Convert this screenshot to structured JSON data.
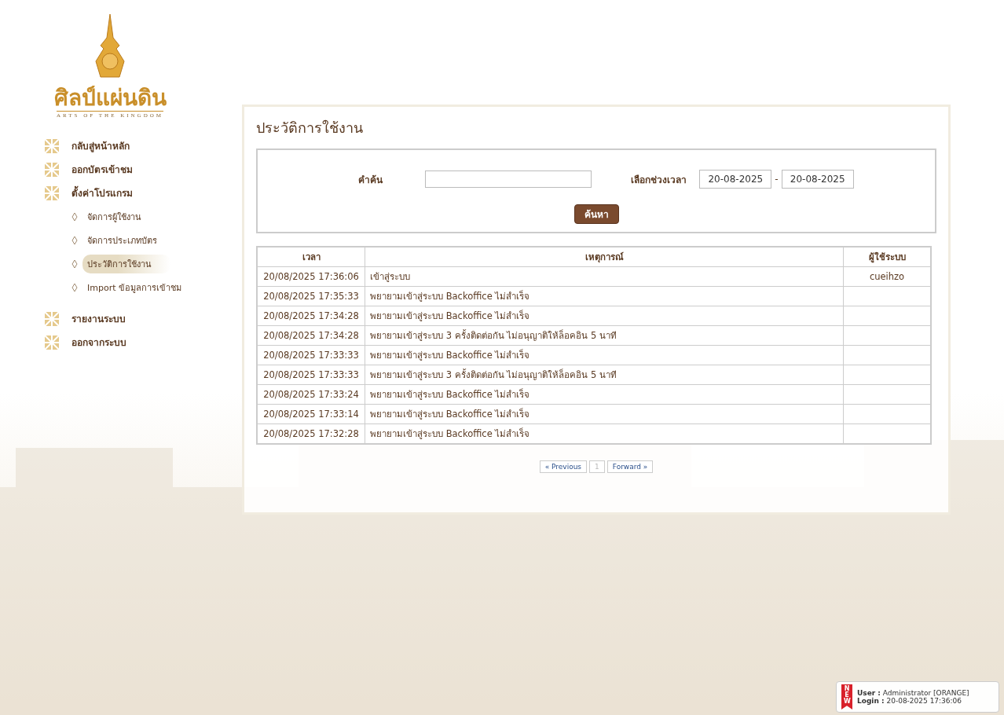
{
  "logo": {
    "title": "ศิลป์แผ่นดิน",
    "subtitle": "ARTS OF THE KINGDOM"
  },
  "menu": [
    {
      "label": "กลับสู่หน้าหลัก"
    },
    {
      "label": "ออกบัตรเข้าชม"
    },
    {
      "label": "ตั้งค่าโปรแกรม",
      "children": [
        {
          "label": "จัดการผู้ใช้งาน",
          "selected": false
        },
        {
          "label": "จัดการประเภทบัตร",
          "selected": false
        },
        {
          "label": "ประวัติการใช้งาน",
          "selected": true
        },
        {
          "label": "Import ข้อมูลการเข้าชม",
          "selected": false
        }
      ]
    },
    {
      "label": "รายงานระบบ"
    },
    {
      "label": "ออกจากระบบ"
    }
  ],
  "page_title": "ประวัติการใช้งาน",
  "search": {
    "keyword_label": "คำค้น",
    "range_label": "เลือกช่วงเวลา",
    "date_from": "20-08-2025",
    "separator": "-",
    "date_to": "20-08-2025",
    "button": "ค้นหา"
  },
  "table": {
    "columns": [
      "เวลา",
      "เหตุการณ์",
      "ผู้ใช้ระบบ"
    ],
    "rows": [
      [
        "20/08/2025 17:36:06",
        "เข้าสู่ระบบ",
        "cueihzo"
      ],
      [
        "20/08/2025 17:35:33",
        "พยายามเข้าสู่ระบบ Backoffice ไม่สำเร็จ",
        ""
      ],
      [
        "20/08/2025 17:34:28",
        "พยายามเข้าสู่ระบบ Backoffice ไม่สำเร็จ",
        ""
      ],
      [
        "20/08/2025 17:34:28",
        "พยายามเข้าสู่ระบบ 3 ครั้งติดต่อกัน ไม่อนุญาติให้ล็อคอิน 5 นาที",
        ""
      ],
      [
        "20/08/2025 17:33:33",
        "พยายามเข้าสู่ระบบ Backoffice ไม่สำเร็จ",
        ""
      ],
      [
        "20/08/2025 17:33:33",
        "พยายามเข้าสู่ระบบ 3 ครั้งติดต่อกัน ไม่อนุญาติให้ล็อคอิน 5 นาที",
        ""
      ],
      [
        "20/08/2025 17:33:24",
        "พยายามเข้าสู่ระบบ Backoffice ไม่สำเร็จ",
        ""
      ],
      [
        "20/08/2025 17:33:14",
        "พยายามเข้าสู่ระบบ Backoffice ไม่สำเร็จ",
        ""
      ],
      [
        "20/08/2025 17:32:28",
        "พยายามเข้าสู่ระบบ Backoffice ไม่สำเร็จ",
        ""
      ]
    ]
  },
  "pagination": [
    {
      "label": "« Previous",
      "disabled": false
    },
    {
      "label": "1",
      "disabled": true
    },
    {
      "label": "Forward »",
      "disabled": false
    }
  ],
  "user_box": {
    "badge": "NEW",
    "user_label": "User :",
    "user": "Administrator [ORANGE]",
    "login_label": "Login :",
    "login": "20-08-2025 17:36:06"
  }
}
